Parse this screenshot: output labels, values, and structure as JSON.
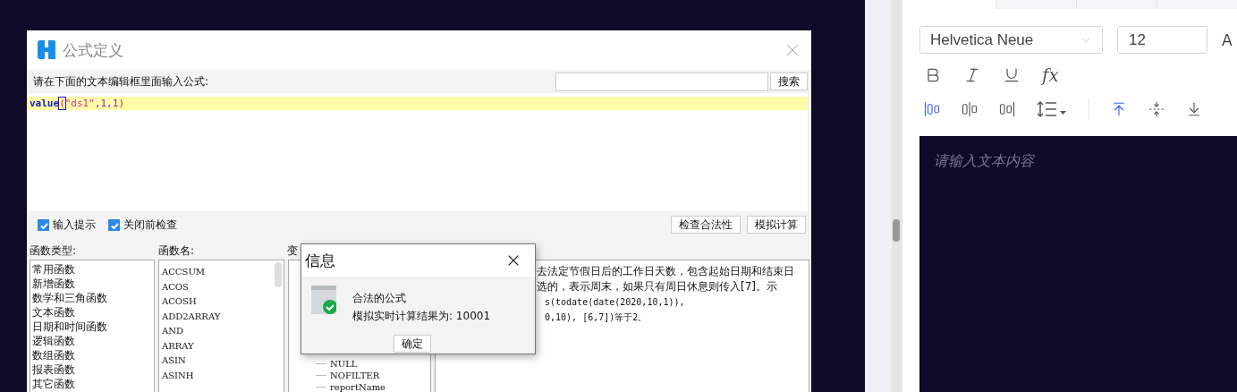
{
  "formula_dialog": {
    "title": "公式定义",
    "prompt": "请在下面的文本编辑框里面输入公式:",
    "search_button": "搜索",
    "formula": [
      {
        "text": "value",
        "kind": "function"
      },
      {
        "text": "(",
        "kind": "paren",
        "matched": true
      },
      {
        "text": "\"ds1\"",
        "kind": "string"
      },
      {
        "text": ",1,1",
        "kind": "number"
      },
      {
        "text": ")",
        "kind": "paren",
        "matched": false
      }
    ],
    "options": [
      {
        "label": "输入提示",
        "checked": true
      },
      {
        "label": "关闭前检查",
        "checked": true
      }
    ],
    "buttons": [
      "检查合法性",
      "模拟计算"
    ],
    "category_label": "函数类型:",
    "categories": [
      "常用函数",
      "新增函数",
      "数学和三角函数",
      "文本函数",
      "日期和时间函数",
      "逻辑函数",
      "数组函数",
      "报表函数",
      "其它函数"
    ],
    "function_label": "函数名:",
    "functions": [
      "ACCSUM",
      "ACOS",
      "ACOSH",
      "ADD2ARRAY",
      "AND",
      "ARRAY",
      "ASIN",
      "ASINH"
    ],
    "variable_label": "变",
    "variables": [
      "NULL",
      "NOFILTER",
      "reportName"
    ],
    "description": [
      {
        "text": "去法定节假日后的工作日天数，包含起始日期和结束日",
        "kind": "text"
      },
      {
        "text": "选的，表示周末，如果只有周日休息则传入[7]。示",
        "kind": "text"
      },
      {
        "text": "s(todate(date(2020,10,1)),",
        "kind": "code"
      },
      {
        "text": "0,10), [6,7])等于2。",
        "kind": "code"
      }
    ]
  },
  "info_dialog": {
    "title": "信息",
    "message": "合法的公式",
    "result": "模拟实时计算结果为: 10001",
    "ok_button": "确定"
  },
  "editor_panel": {
    "font": "Helvetica Neue",
    "size": "12",
    "cut_label": "A",
    "formula_button": "fx",
    "align": [
      {
        "kind": "left",
        "selected": true
      },
      {
        "kind": "center",
        "selected": false
      },
      {
        "kind": "right",
        "selected": false
      }
    ],
    "vertical_align": [
      {
        "kind": "top",
        "selected": true
      },
      {
        "kind": "middle",
        "selected": false
      },
      {
        "kind": "bottom",
        "selected": false
      }
    ],
    "placeholder": "请输入文本内容"
  }
}
